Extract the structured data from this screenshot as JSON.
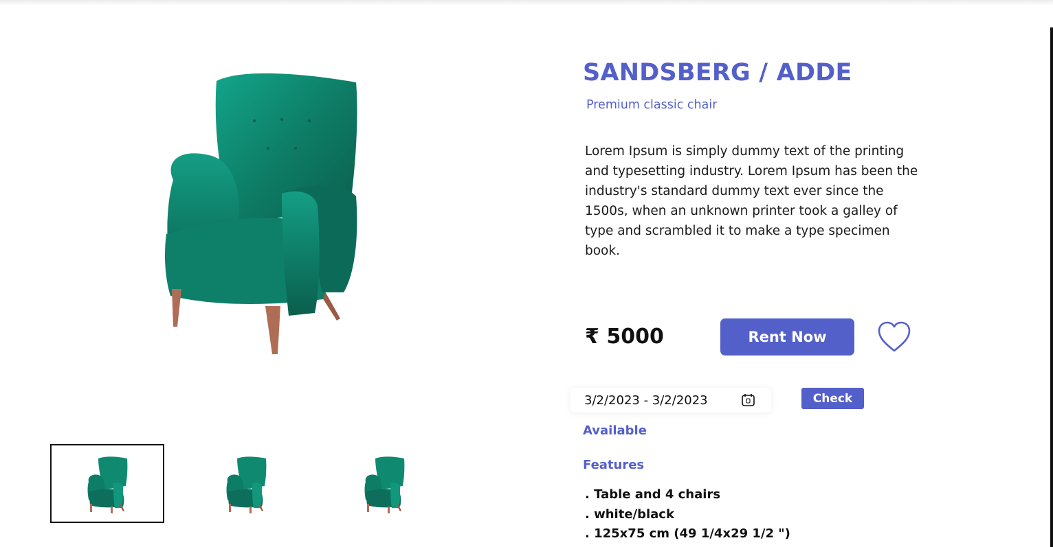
{
  "product": {
    "title": "SANDSBERG / ADDE",
    "subtitle": "Premium classic chair",
    "description": "Lorem Ipsum is simply dummy text of the printing and typesetting industry. Lorem Ipsum has been the industry's standard dummy text ever since the 1500s, when an unknown printer took a galley of type and scrambled it to make a type specimen book.",
    "price": "₹ 5000",
    "main_image_icon": "green-armchair-image",
    "colors": {
      "accent": "#5460c9",
      "chair": "#0f7a64",
      "legs": "#b06d55"
    }
  },
  "gallery": {
    "thumbnails": [
      {
        "icon": "green-armchair-thumbnail",
        "selected": true
      },
      {
        "icon": "green-armchair-thumbnail",
        "selected": false
      },
      {
        "icon": "green-armchair-thumbnail",
        "selected": false
      }
    ]
  },
  "actions": {
    "rent_label": "Rent Now",
    "wishlist_icon": "heart-icon",
    "check_label": "Check"
  },
  "availability": {
    "date_range": "3/2/2023 - 3/2/2023",
    "calendar_icon": "calendar-icon",
    "status": "Available"
  },
  "features": {
    "heading": "Features",
    "items": [
      ". Table and 4 chairs",
      ". white/black",
      ". 125x75 cm (49 1/4x29 1/2 \")"
    ]
  }
}
